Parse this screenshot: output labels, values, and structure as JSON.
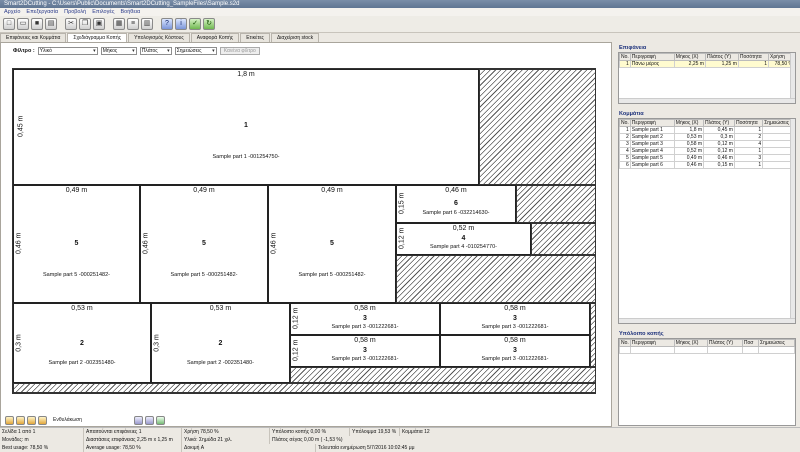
{
  "window": {
    "title": "Smart2DCutting - C:\\Users\\Public\\Documents\\Smart2DCutting_SampleFiles\\Sample.s2d"
  },
  "menu": [
    "Αρχείο",
    "Επεξεργασία",
    "Προβολή",
    "Επιλογές",
    "Βοήθεια"
  ],
  "toolbar_icons": [
    "new-icon",
    "open-icon",
    "save-icon",
    "print-icon",
    "cut-icon",
    "copy-icon",
    "paste-icon",
    "calculate-icon",
    "list-icon",
    "chart-icon",
    "help-icon",
    "info-icon",
    "settings-icon",
    "exit-icon"
  ],
  "tabs": [
    "Επιφάνειες και Κομμάτια",
    "Σχεδιάγραμμα Κοπής",
    "Υπολογισμός Κόστους",
    "Αναφορά Κοπής",
    "Ετικέτες",
    "Διαχείριση stock"
  ],
  "filter": {
    "label": "Φίλτρο :",
    "material": "Υλικό",
    "length": "Μήκος",
    "width": "Πλάτος",
    "note": "Σημειώσεις",
    "button": "Κανένα φίλτρο"
  },
  "layout": {
    "board_width": "1,8 m",
    "board_height": "0,45 m",
    "board_number": "1",
    "board_label": "Sample part 1  -001254750-",
    "parts5": [
      {
        "w": "0,49 m",
        "h": "0,46 m",
        "n": "5",
        "lbl": "Sample part 5  -000251482-"
      },
      {
        "w": "0,49 m",
        "h": "0,46 m",
        "n": "5",
        "lbl": "Sample part 5  -000251482-"
      },
      {
        "w": "0,49 m",
        "h": "0,46 m",
        "n": "5",
        "lbl": "Sample part 5  -000251482-"
      }
    ],
    "part6": {
      "w": "0,46 m",
      "h": "0,15 m",
      "n": "6",
      "lbl": "Sample part 6  -032214630-"
    },
    "part4": {
      "w": "0,52 m",
      "h": "0,12 m",
      "n": "4",
      "lbl": "Sample part 4  -010254770-"
    },
    "parts2": [
      {
        "w": "0,53 m",
        "h": "0,3 m",
        "n": "2",
        "lbl": "Sample part 2  -002351480-"
      },
      {
        "w": "0,53 m",
        "h": "0,3 m",
        "n": "2",
        "lbl": "Sample part 2  -002351480-"
      }
    ],
    "parts3": [
      {
        "w": "0,58 m",
        "h": "0,12 m",
        "n": "3",
        "lbl": "Sample part 3  -001222681-"
      },
      {
        "w": "0,58 m",
        "h": "",
        "n": "3",
        "lbl": "Sample part 3  -001222681-"
      },
      {
        "w": "0,58 m",
        "h": "0,12 m",
        "n": "3",
        "lbl": "Sample part 3  -001222681-"
      },
      {
        "w": "0,58 m",
        "h": "",
        "n": "3",
        "lbl": "Sample part 3  -001222681-"
      }
    ]
  },
  "bottom_tools": {
    "label": "Ενθυλάκωση"
  },
  "surfaces": {
    "title": "Επιφάνεια",
    "headers": [
      "No.",
      "Περιγραφή",
      "Μήκος (X)",
      "Πλάτος (Y)",
      "Ποσότητα",
      "Χρήση"
    ],
    "rows": [
      [
        "1",
        "Πάνω μέρος",
        "2,25 m",
        "1,25 m",
        "1",
        "78,50 %"
      ]
    ]
  },
  "parts": {
    "title": "Κομμάτια",
    "headers": [
      "No.",
      "Περιγραφή",
      "Μήκος (X)",
      "Πλάτος (Y)",
      "Ποσότητα",
      "Σημειώσεις"
    ],
    "rows": [
      [
        "1",
        "Sample part 1",
        "1,8 m",
        "0,45 m",
        "1",
        ""
      ],
      [
        "2",
        "Sample part 2",
        "0,53 m",
        "0,3 m",
        "2",
        ""
      ],
      [
        "3",
        "Sample part 3",
        "0,58 m",
        "0,12 m",
        "4",
        ""
      ],
      [
        "4",
        "Sample part 4",
        "0,52 m",
        "0,12 m",
        "1",
        ""
      ],
      [
        "5",
        "Sample part 5",
        "0,49 m",
        "0,46 m",
        "3",
        ""
      ],
      [
        "6",
        "Sample part 6",
        "0,46 m",
        "0,15 m",
        "1",
        ""
      ]
    ]
  },
  "remaining": {
    "title": "Υπόλοιπο κοπής",
    "headers": [
      "No.",
      "Περιγραφή",
      "Μήκος (X)",
      "Πλάτος (Y)",
      "Ποσ",
      "Σημειώσεις"
    ]
  },
  "status": {
    "row1": [
      "Σελίδα 1 από 1",
      "Απαιτούνται επιφάνειες 1",
      "Χρήση 78,50 %",
      "Υπόλοιπο κοπής 0,00 %",
      "Υπόλοιμμα 19,53 %",
      "Κομμάτια 12"
    ],
    "row2": [
      "Μονάδες: m",
      "Διαστάσεις επιφάνειας 2,25 m x 1,25 m",
      "Υλικό: Σημύδα 21 χιλ.",
      "Πλάτος σέγας 0,00 m  ( -1,53 %)"
    ],
    "row3": [
      "Best usage: 78,50 %",
      "Average usage: 78,50 %",
      "Δοκιμή A",
      "Τελευταία ενημέρωση 5/7/2016 10:02:45 μμ"
    ]
  }
}
